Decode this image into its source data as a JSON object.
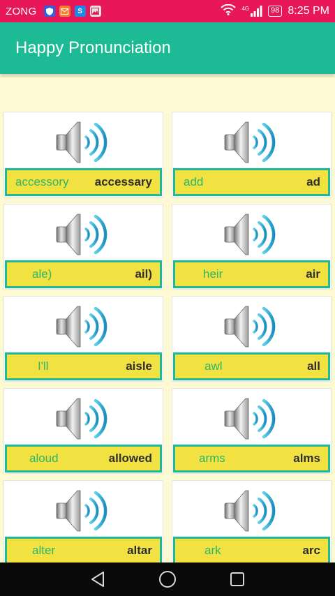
{
  "status_bar": {
    "carrier": "ZONG",
    "network": "4G",
    "battery": "98",
    "time": "8:25 PM",
    "icons": [
      "shield-icon",
      "mail-icon",
      "s-app-icon",
      "gallery-icon",
      "wifi-icon",
      "signal-icon",
      "battery-icon"
    ]
  },
  "app_bar": {
    "title": "Happy Pronunciation"
  },
  "cards": [
    {
      "a": "accessory",
      "b": "accessary"
    },
    {
      "a": "add",
      "b": "ad"
    },
    {
      "a": "ale)",
      "b": "ail)"
    },
    {
      "a": "heir",
      "b": "air"
    },
    {
      "a": "I'll",
      "b": "aisle"
    },
    {
      "a": "awl",
      "b": "all"
    },
    {
      "a": "aloud",
      "b": "allowed"
    },
    {
      "a": "arms",
      "b": "alms"
    },
    {
      "a": "alter",
      "b": "altar"
    },
    {
      "a": "ark",
      "b": "arc"
    }
  ],
  "nav_bar": {
    "icons": [
      "back-icon",
      "home-icon",
      "recents-icon"
    ]
  },
  "colors": {
    "status": "#e8175a",
    "accent": "#1dbb95",
    "word_bar": "#f2e241",
    "background": "#fdf9d3"
  }
}
